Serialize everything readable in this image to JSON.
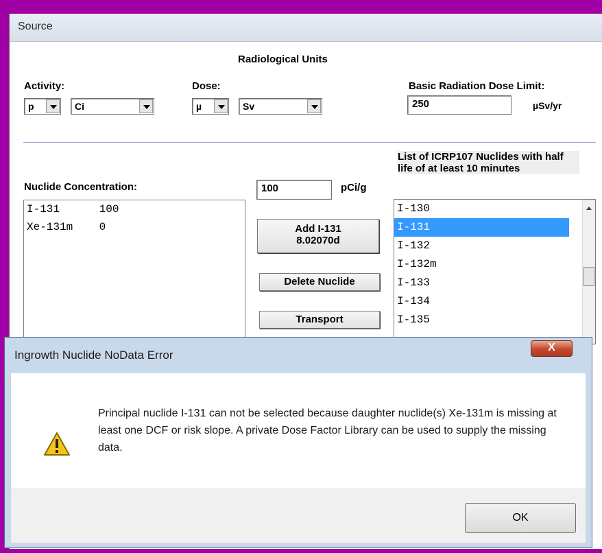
{
  "source_window": {
    "title": "Source",
    "heading": "Radiological Units",
    "activity": {
      "label": "Activity:",
      "prefix": "p",
      "unit": "Ci"
    },
    "dose": {
      "label": "Dose:",
      "prefix": "µ",
      "unit": "Sv"
    },
    "dose_limit": {
      "label": "Basic Radiation Dose Limit:",
      "value": "250",
      "unit": "µSv/yr"
    },
    "concentration": {
      "label": "Nuclide Concentration:",
      "value": "100",
      "unit": "pCi/g",
      "rows": [
        "I-131      100",
        "Xe-131m    0"
      ]
    },
    "buttons": {
      "add_line1": "Add I-131",
      "add_line2": "8.02070d",
      "delete": "Delete Nuclide",
      "transport": "Transport"
    },
    "nuclide_list": {
      "header": "List of ICRP107 Nuclides with half life of at least 10 minutes",
      "items": [
        "I-130",
        "I-131",
        "I-132",
        "I-132m",
        "I-133",
        "I-134",
        "I-135"
      ],
      "selected": "I-131"
    }
  },
  "dialog": {
    "title": "Ingrowth Nuclide NoData Error",
    "close_label": "X",
    "message": "Principal nuclide I-131 can not be selected because daughter nuclide(s) Xe-131m is missing at least one DCF or risk slope.  A private Dose Factor Library can be used to supply the missing data.",
    "ok_label": "OK",
    "icon": "warning-icon"
  }
}
